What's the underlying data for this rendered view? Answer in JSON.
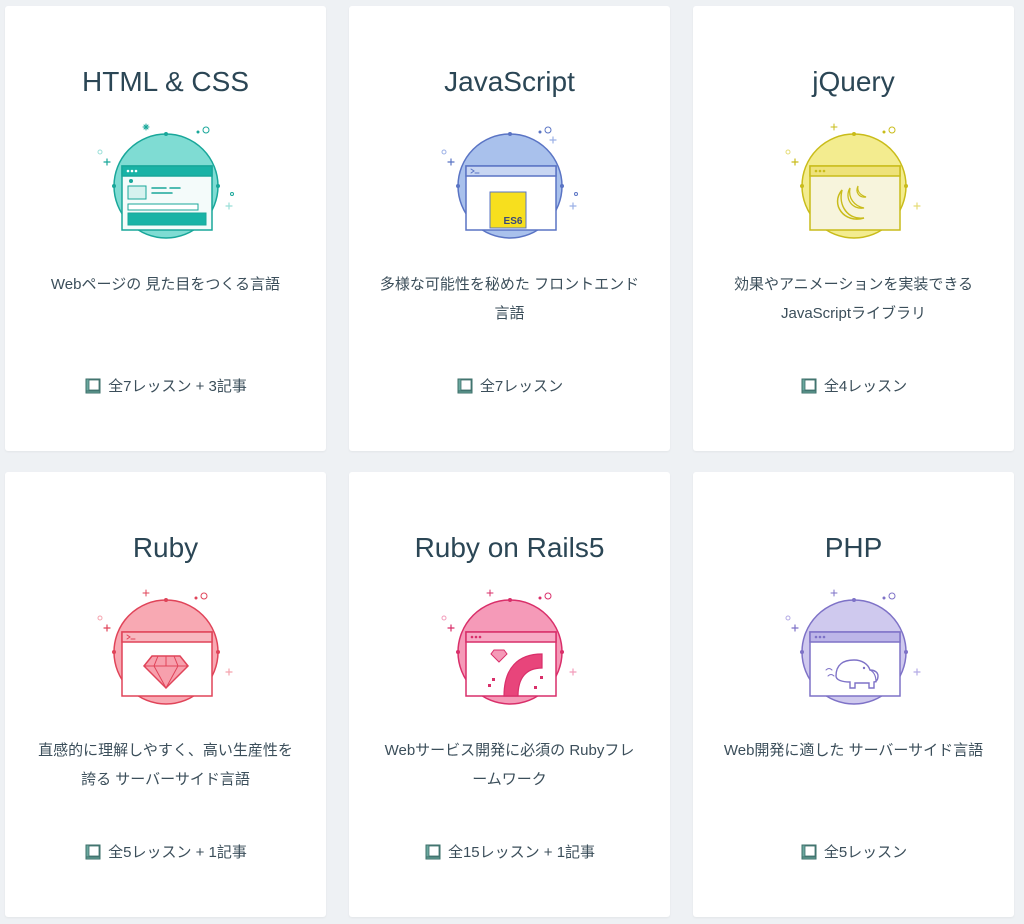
{
  "courses": [
    {
      "title": "HTML & CSS",
      "desc": [
        "Webページの 見た目をつくる言語"
      ],
      "meta": "全7レッスン + 3記事",
      "icon": "html-css-icon",
      "colors": {
        "fill": "#7fdcd3",
        "stroke": "#19a79a",
        "screen": "#f4fbfa",
        "bar": "#19b3a6"
      }
    },
    {
      "title": "JavaScript",
      "desc": [
        "多様な可能性を秘めた フロントエンド",
        "言語"
      ],
      "meta": "全7レッスン",
      "icon": "javascript-icon",
      "colors": {
        "fill": "#a9c1ec",
        "stroke": "#5a74c4",
        "screen": "#ffffff",
        "bar": "#c8d6f2"
      },
      "badge": "ES6"
    },
    {
      "title": "jQuery",
      "desc": [
        "効果やアニメーションを実装できる",
        "JavaScriptライブラリ"
      ],
      "meta": "全4レッスン",
      "icon": "jquery-icon",
      "colors": {
        "fill": "#f3ec8f",
        "stroke": "#c9bc1a",
        "screen": "#f7f4dc",
        "bar": "#eee27a"
      }
    },
    {
      "title": "Ruby",
      "desc": [
        "直感的に理解しやすく、高い生産性を",
        "誇る サーバーサイド言語"
      ],
      "meta": "全5レッスン + 1記事",
      "icon": "ruby-icon",
      "colors": {
        "fill": "#f8a9b3",
        "stroke": "#e04459",
        "screen": "#ffffff",
        "bar": "#f8b8c0"
      }
    },
    {
      "title": "Ruby on Rails5",
      "desc": [
        "Webサービス開発に必須の Rubyフレ",
        "ームワーク"
      ],
      "meta": "全15レッスン + 1記事",
      "icon": "rails-icon",
      "colors": {
        "fill": "#f59ab8",
        "stroke": "#d92f6a",
        "screen": "#ffffff",
        "bar": "#f7aac5"
      }
    },
    {
      "title": "PHP",
      "desc": [
        "Web開発に適した サーバーサイド言語"
      ],
      "meta": "全5レッスン",
      "icon": "php-icon",
      "colors": {
        "fill": "#cfc9ee",
        "stroke": "#7e72c7",
        "screen": "#ffffff",
        "bar": "#bdb6e8"
      }
    }
  ]
}
